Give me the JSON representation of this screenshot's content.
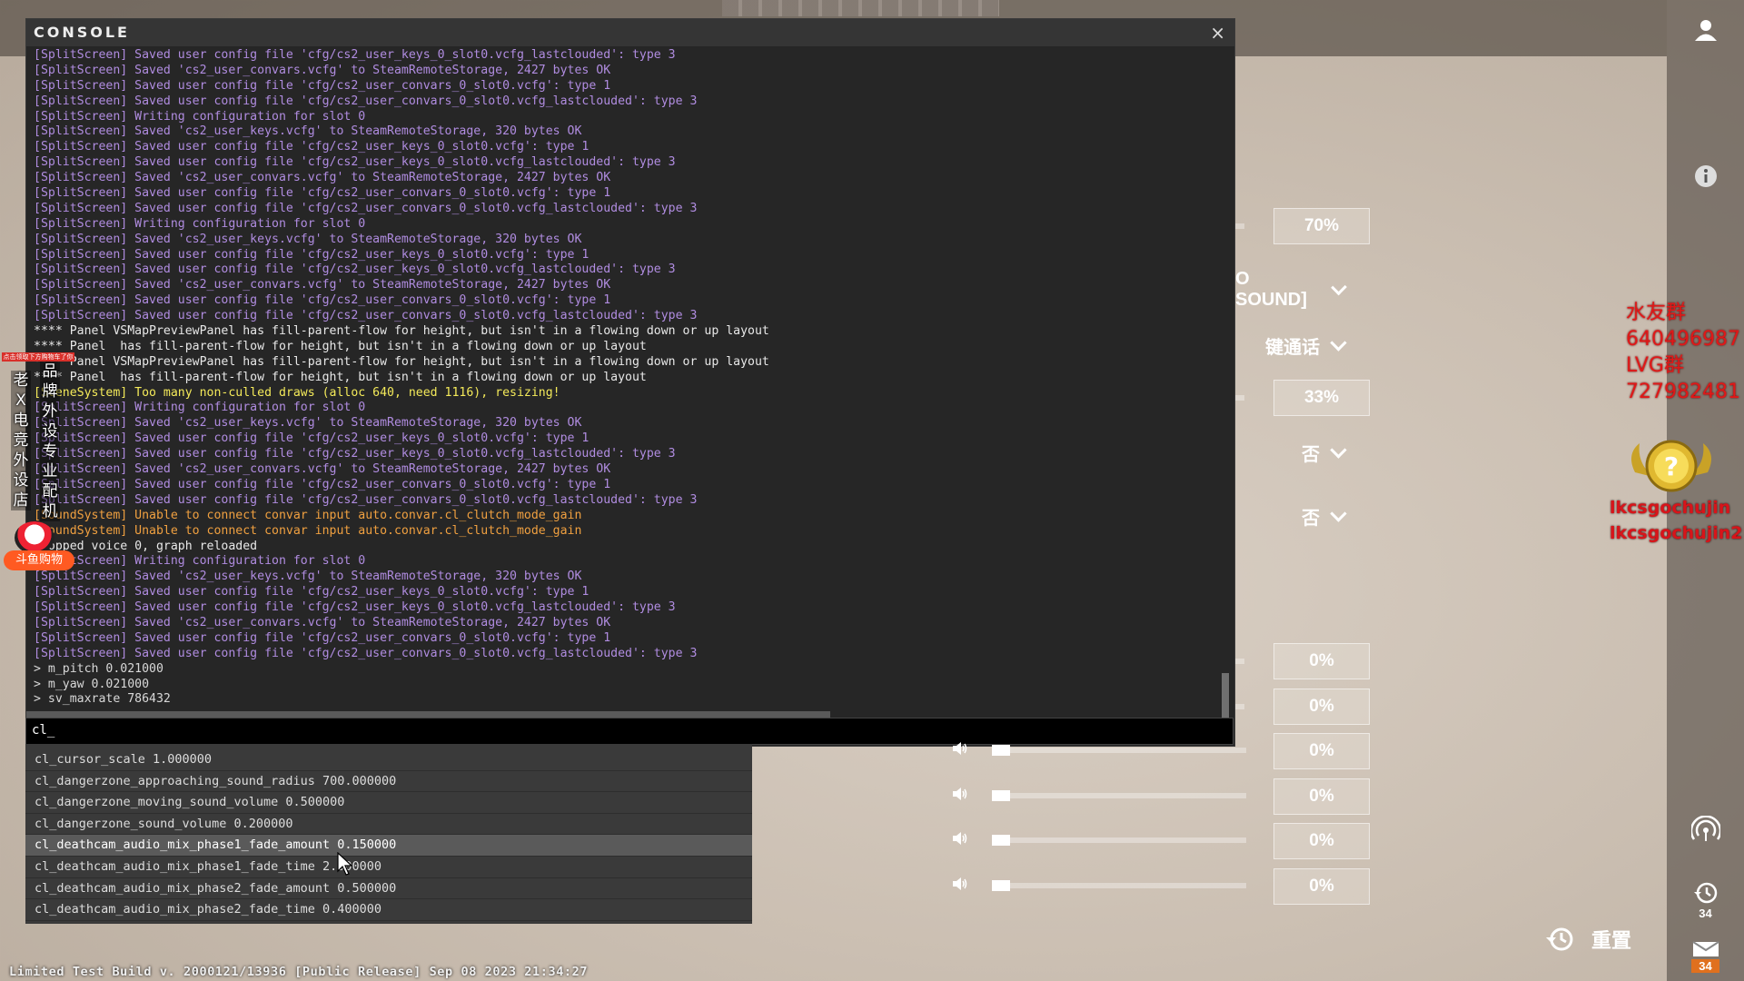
{
  "console": {
    "title": "CONSOLE",
    "close_glyph": "×",
    "input_value": "cl_",
    "log": [
      {
        "t": "[SplitScreen] Saved user config file 'cfg/cs2_user_keys_0_slot0.vcfg_lastclouded': type 3",
        "c": "split"
      },
      {
        "t": "[SplitScreen] Saved 'cs2_user_convars.vcfg' to SteamRemoteStorage, 2427 bytes OK",
        "c": "split"
      },
      {
        "t": "[SplitScreen] Saved user config file 'cfg/cs2_user_convars_0_slot0.vcfg': type 1",
        "c": "split"
      },
      {
        "t": "[SplitScreen] Saved user config file 'cfg/cs2_user_convars_0_slot0.vcfg_lastclouded': type 3",
        "c": "split"
      },
      {
        "t": "[SplitScreen] Writing configuration for slot 0",
        "c": "split"
      },
      {
        "t": "[SplitScreen] Saved 'cs2_user_keys.vcfg' to SteamRemoteStorage, 320 bytes OK",
        "c": "split"
      },
      {
        "t": "[SplitScreen] Saved user config file 'cfg/cs2_user_keys_0_slot0.vcfg': type 1",
        "c": "split"
      },
      {
        "t": "[SplitScreen] Saved user config file 'cfg/cs2_user_keys_0_slot0.vcfg_lastclouded': type 3",
        "c": "split"
      },
      {
        "t": "[SplitScreen] Saved 'cs2_user_convars.vcfg' to SteamRemoteStorage, 2427 bytes OK",
        "c": "split"
      },
      {
        "t": "[SplitScreen] Saved user config file 'cfg/cs2_user_convars_0_slot0.vcfg': type 1",
        "c": "split"
      },
      {
        "t": "[SplitScreen] Saved user config file 'cfg/cs2_user_convars_0_slot0.vcfg_lastclouded': type 3",
        "c": "split"
      },
      {
        "t": "[SplitScreen] Writing configuration for slot 0",
        "c": "split"
      },
      {
        "t": "[SplitScreen] Saved 'cs2_user_keys.vcfg' to SteamRemoteStorage, 320 bytes OK",
        "c": "split"
      },
      {
        "t": "[SplitScreen] Saved user config file 'cfg/cs2_user_keys_0_slot0.vcfg': type 1",
        "c": "split"
      },
      {
        "t": "[SplitScreen] Saved user config file 'cfg/cs2_user_keys_0_slot0.vcfg_lastclouded': type 3",
        "c": "split"
      },
      {
        "t": "[SplitScreen] Saved 'cs2_user_convars.vcfg' to SteamRemoteStorage, 2427 bytes OK",
        "c": "split"
      },
      {
        "t": "[SplitScreen] Saved user config file 'cfg/cs2_user_convars_0_slot0.vcfg': type 1",
        "c": "split"
      },
      {
        "t": "[SplitScreen] Saved user config file 'cfg/cs2_user_convars_0_slot0.vcfg_lastclouded': type 3",
        "c": "split"
      },
      {
        "t": "**** Panel VSMapPreviewPanel has fill-parent-flow for height, but isn't in a flowing down or up layout",
        "c": "panel"
      },
      {
        "t": "**** Panel  has fill-parent-flow for height, but isn't in a flowing down or up layout",
        "c": "panel"
      },
      {
        "t": "**** Panel VSMapPreviewPanel has fill-parent-flow for height, but isn't in a flowing down or up layout",
        "c": "panel"
      },
      {
        "t": "**** Panel  has fill-parent-flow for height, but isn't in a flowing down or up layout",
        "c": "panel"
      },
      {
        "t": "[SceneSystem] Too many non-culled draws (alloc 640, need 1116), resizing!",
        "c": "warn"
      },
      {
        "t": "[SplitScreen] Writing configuration for slot 0",
        "c": "split"
      },
      {
        "t": "[SplitScreen] Saved 'cs2_user_keys.vcfg' to SteamRemoteStorage, 320 bytes OK",
        "c": "split"
      },
      {
        "t": "[SplitScreen] Saved user config file 'cfg/cs2_user_keys_0_slot0.vcfg': type 1",
        "c": "split"
      },
      {
        "t": "[SplitScreen] Saved user config file 'cfg/cs2_user_keys_0_slot0.vcfg_lastclouded': type 3",
        "c": "split"
      },
      {
        "t": "[SplitScreen] Saved 'cs2_user_convars.vcfg' to SteamRemoteStorage, 2427 bytes OK",
        "c": "split"
      },
      {
        "t": "[SplitScreen] Saved user config file 'cfg/cs2_user_convars_0_slot0.vcfg': type 1",
        "c": "split"
      },
      {
        "t": "[SplitScreen] Saved user config file 'cfg/cs2_user_convars_0_slot0.vcfg_lastclouded': type 3",
        "c": "split"
      },
      {
        "t": "[SoundSystem] Unable to connect convar input auto.convar.cl_clutch_mode_gain",
        "c": "sound"
      },
      {
        "t": "[SoundSystem] Unable to connect convar input auto.convar.cl_clutch_mode_gain",
        "c": "sound"
      },
      {
        "t": "Stopped voice 0, graph reloaded",
        "c": "panel"
      },
      {
        "t": "[SplitScreen] Writing configuration for slot 0",
        "c": "split"
      },
      {
        "t": "[SplitScreen] Saved 'cs2_user_keys.vcfg' to SteamRemoteStorage, 320 bytes OK",
        "c": "split"
      },
      {
        "t": "[SplitScreen] Saved user config file 'cfg/cs2_user_keys_0_slot0.vcfg': type 1",
        "c": "split"
      },
      {
        "t": "[SplitScreen] Saved user config file 'cfg/cs2_user_keys_0_slot0.vcfg_lastclouded': type 3",
        "c": "split"
      },
      {
        "t": "[SplitScreen] Saved 'cs2_user_convars.vcfg' to SteamRemoteStorage, 2427 bytes OK",
        "c": "split"
      },
      {
        "t": "[SplitScreen] Saved user config file 'cfg/cs2_user_convars_0_slot0.vcfg': type 1",
        "c": "split"
      },
      {
        "t": "[SplitScreen] Saved user config file 'cfg/cs2_user_convars_0_slot0.vcfg_lastclouded': type 3",
        "c": "split"
      },
      {
        "t": "> m_pitch 0.021000",
        "c": "cmd"
      },
      {
        "t": "> m_yaw 0.021000",
        "c": "cmd"
      },
      {
        "t": "> sv_maxrate 786432",
        "c": "cmd"
      }
    ]
  },
  "autocomplete": {
    "items": [
      {
        "text": "cl_cursor_scale 1.000000",
        "highlighted": false
      },
      {
        "text": "cl_dangerzone_approaching_sound_radius 700.000000",
        "highlighted": false
      },
      {
        "text": "cl_dangerzone_moving_sound_volume 0.500000",
        "highlighted": false
      },
      {
        "text": "cl_dangerzone_sound_volume 0.200000",
        "highlighted": false
      },
      {
        "text": "cl_deathcam_audio_mix_phase1_fade_amount 0.150000",
        "highlighted": true
      },
      {
        "text": "cl_deathcam_audio_mix_phase1_fade_time 2.000000",
        "highlighted": false
      },
      {
        "text": "cl_deathcam_audio_mix_phase2_fade_amount 0.500000",
        "highlighted": false
      },
      {
        "text": "cl_deathcam_audio_mix_phase2_fade_time 0.400000",
        "highlighted": false
      }
    ]
  },
  "settings": {
    "rows": [
      {
        "kind": "percent",
        "value": "70%"
      },
      {
        "kind": "dropdown",
        "value": "O SOUND]"
      },
      {
        "kind": "dropdown",
        "value": "键通话"
      },
      {
        "kind": "percent",
        "value": "33%"
      },
      {
        "kind": "dropdown",
        "value": "否"
      },
      {
        "kind": "dropdown",
        "value": "否"
      },
      {
        "kind": "percent",
        "value": "0%"
      },
      {
        "kind": "percent",
        "value": "0%"
      },
      {
        "kind": "slider",
        "value": "0%",
        "level": 0
      },
      {
        "kind": "slider",
        "value": "0%",
        "level": 0
      },
      {
        "kind": "slider",
        "value": "0%",
        "level": 0
      },
      {
        "kind": "slider",
        "value": "0%",
        "level": 0
      }
    ],
    "reset_label": "重置"
  },
  "sidebar": {
    "icons": [
      "user-icon",
      "info-icon",
      "broadcast-icon",
      "history-icon",
      "mail-icon"
    ],
    "history_count": "34",
    "mail_count": "34"
  },
  "footer": {
    "build_text": "Limited Test Build v. 2000121/13936 [Public Release] Sep 08 2023 21:34:27"
  },
  "overlay": {
    "left_banner": "点击领取下方购物车了你",
    "left_col1": "老X电竞外设店",
    "left_col2": "品牌外设专业配机",
    "left_shop": "斗鱼购物",
    "right_lines": [
      "水友群",
      "640496987",
      "LVG群",
      "727982481"
    ],
    "streamer_name": "lkcsgochujin",
    "streamer_name2": "lkcsgochujin2"
  },
  "colors": {
    "log_split": "#b08ce0",
    "log_warn": "#f4ea5a",
    "log_sound": "#f0a040",
    "badge_orange": "#e0701e",
    "overlay_red": "#e01818"
  }
}
